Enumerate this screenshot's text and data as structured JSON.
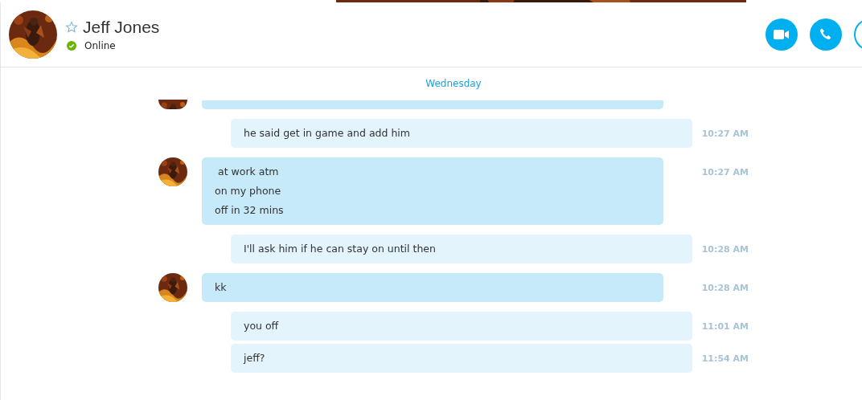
{
  "contact": {
    "name": "Jeff Jones",
    "favorite": false,
    "status": "Online"
  },
  "date_divider": "Wednesday",
  "messages": [
    {
      "kind": "outgoing",
      "lines": [
        "he said get in game and add him"
      ],
      "time": "10:27 AM"
    },
    {
      "kind": "incoming",
      "lines": [
        " at work atm",
        "on my phone",
        "off in 32 mins"
      ],
      "time": "10:27 AM"
    },
    {
      "kind": "outgoing",
      "lines": [
        "I'll ask him if he can stay on until then"
      ],
      "time": "10:28 AM"
    },
    {
      "kind": "incoming",
      "lines": [
        "kk"
      ],
      "time": "10:28 AM"
    },
    {
      "kind": "outgoing",
      "lines": [
        "you off"
      ],
      "time": "11:01 AM"
    },
    {
      "kind": "outgoing",
      "lines": [
        "jeff?"
      ],
      "time": "11:54 AM"
    }
  ]
}
